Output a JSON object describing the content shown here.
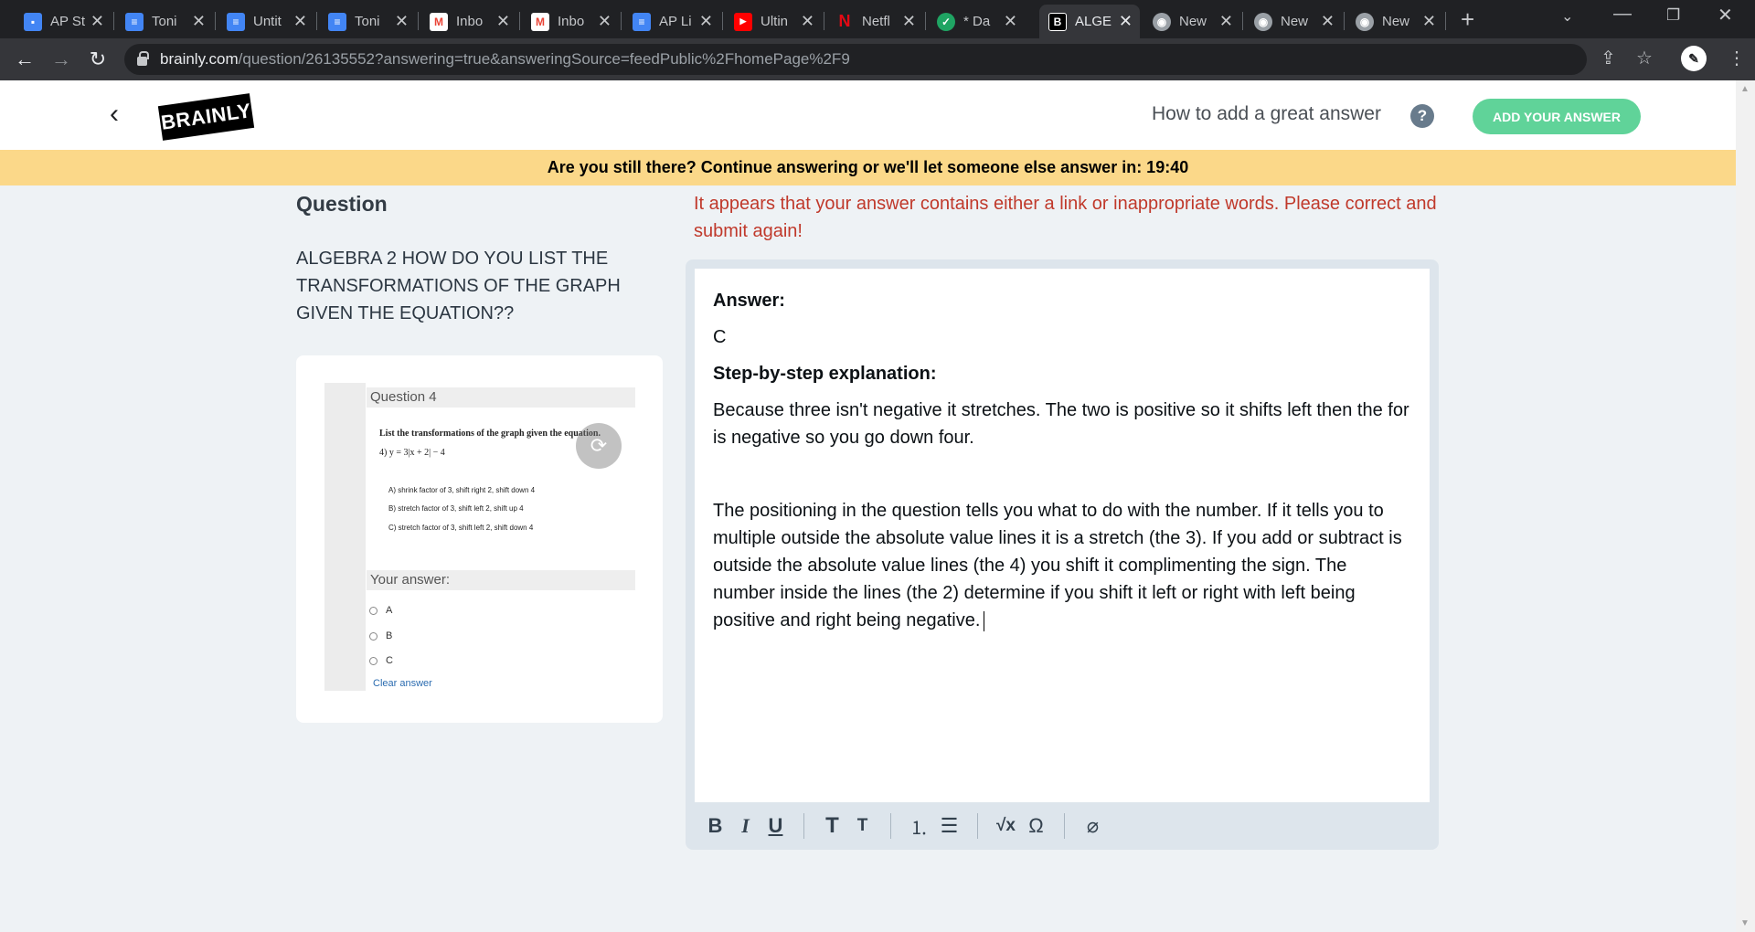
{
  "browser": {
    "tabs": [
      {
        "title": "AP St",
        "icon": "contacts-icon",
        "color": "#4285f4"
      },
      {
        "title": "Toni",
        "icon": "docs-icon",
        "color": "#4285f4"
      },
      {
        "title": "Untit",
        "icon": "docs-icon",
        "color": "#4285f4"
      },
      {
        "title": "Toni",
        "icon": "docs-icon",
        "color": "#4285f4"
      },
      {
        "title": "Inbo",
        "icon": "gmail-icon",
        "color": "#ea4335"
      },
      {
        "title": "Inbo",
        "icon": "gmail-icon",
        "color": "#ea4335"
      },
      {
        "title": "AP Li",
        "icon": "docs-icon",
        "color": "#4285f4"
      },
      {
        "title": "Ultin",
        "icon": "youtube-icon",
        "color": "#ff0000"
      },
      {
        "title": "Netfl",
        "icon": "netflix-icon",
        "color": "#e50914"
      },
      {
        "title": "* Da",
        "icon": "checkmark-shield-icon",
        "color": "#1fa463"
      },
      {
        "title": "ALGE",
        "icon": "brainly-icon",
        "color": "#000000"
      },
      {
        "title": "New",
        "icon": "chrome-icon",
        "color": "#9aa0a6"
      },
      {
        "title": "New",
        "icon": "chrome-icon",
        "color": "#9aa0a6"
      },
      {
        "title": "New",
        "icon": "chrome-icon",
        "color": "#9aa0a6"
      }
    ],
    "url_domain": "brainly.com",
    "url_path": "/question/26135552?answering=true&answeringSource=feedPublic%2FhomePage%2F9"
  },
  "header": {
    "logo_text": "BRAINLY",
    "how_to": "How to add a great answer",
    "help_glyph": "?",
    "add_answer_button": "ADD YOUR ANSWER"
  },
  "banner": {
    "text": "Are you still there? Continue answering or we'll let someone else answer in: 19:40"
  },
  "question": {
    "heading": "Question",
    "text": "ALGEBRA 2 HOW DO YOU LIST THE TRANSFORMATIONS OF THE GRAPH GIVEN THE EQUATION??",
    "attachment": {
      "header": "Question 4",
      "instruction": "List the transformations of the graph given the equation.",
      "equation": "4)  y = 3|x + 2| − 4",
      "choices": [
        "A) shrink factor of 3, shift right 2, shift down 4",
        "B) stretch factor of 3, shift left 2, shift up 4",
        "C) stretch factor of 3, shift left 2, shift down 4"
      ],
      "your_answer": "Your answer:",
      "options": [
        "A",
        "B",
        "C"
      ],
      "clear_answer": "Clear answer"
    }
  },
  "answer": {
    "warning": "It appears that your answer contains either a link or inappropriate words. Please correct and submit again!",
    "label_answer": "Answer:",
    "answer_value": "C",
    "label_steps": "Step-by-step explanation:",
    "para1": "Because three isn't negative it stretches.  The two is positive so it shifts left then the for is negative so you go down four.",
    "para2": "The positioning in the question tells you what to do with the number.  If it tells you to multiple outside the absolute value lines it is a stretch (the 3). If you add or subtract is outside the absolute value lines (the 4) you shift it complimenting the sign. The number inside the lines (the 2) determine if you shift it left or right with left being positive and right being negative."
  },
  "colors": {
    "accent_green": "#60d399",
    "banner_yellow": "#fbd889",
    "warning_red": "#c0392b"
  }
}
